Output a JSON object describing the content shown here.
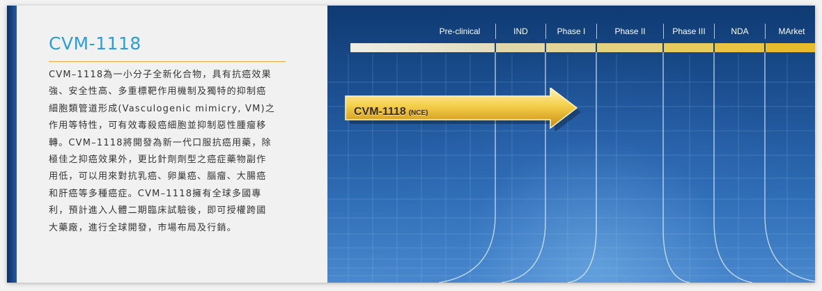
{
  "product": {
    "title": "CVM-1118",
    "description_lines": [
      "CVM–1118為一小分子全新化合物，具有抗癌效果",
      "強、安全性高、多重標靶作用機制及獨特的抑制癌",
      "細胞類管道形成(Vasculogenic mimicry, VM)之",
      "作用等特性，可有效毒殺癌細胞並抑制惡性腫瘤移",
      "轉。CVM–1118將開發為新一代口服抗癌用藥，除",
      "極佳之抑癌效果外，更比針劑劑型之癌症藥物副作",
      "用低，可以用來對抗乳癌、卵巢癌、腦瘤、大腸癌",
      "和肝癌等多種癌症。CVM–1118擁有全球多國專",
      "利，預計進入人體二期臨床試驗後，即可授權跨國",
      "大藥廠，進行全球開發，市場布局及行銷。"
    ]
  },
  "pipeline": {
    "phases": [
      "Pre-clinical",
      "IND",
      "Phase I",
      "Phase II",
      "Phase III",
      "NDA",
      "MArket"
    ],
    "arrow_label": "CVM-1118",
    "arrow_tag": "(NCE)",
    "colors": {
      "title": "#2a9fd6",
      "rule": "#e3a93a",
      "track_start": "#ece9d8",
      "track_end": "#e8b82e",
      "arrow": "#f2c43a"
    }
  }
}
